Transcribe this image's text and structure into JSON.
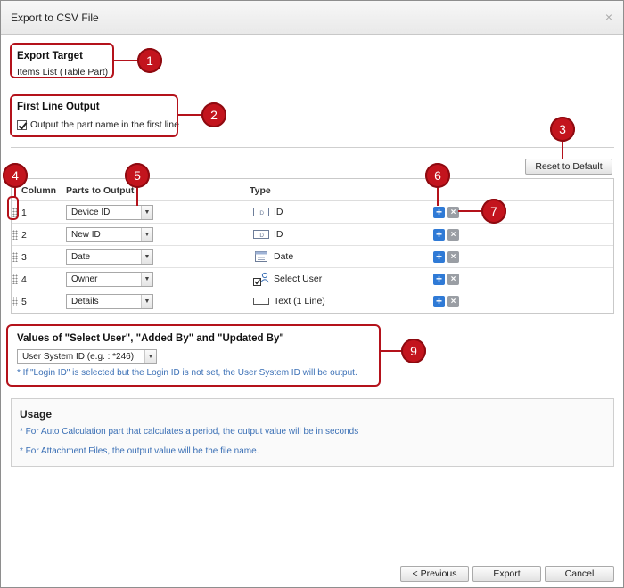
{
  "window": {
    "title": "Export to CSV File",
    "close_glyph": "×"
  },
  "export_target": {
    "title": "Export Target",
    "value": "Items List (Table Part)"
  },
  "first_line": {
    "title": "First Line Output",
    "checkbox_label": "Output the part name in the first line",
    "checked": true
  },
  "toolbar": {
    "reset_label": "Reset to Default"
  },
  "table": {
    "headers": {
      "column": "Column",
      "parts": "Parts to Output",
      "type": "Type"
    },
    "rows": [
      {
        "num": "1",
        "part": "Device ID",
        "type": "ID",
        "type_icon": "id-icon"
      },
      {
        "num": "2",
        "part": "New ID",
        "type": "ID",
        "type_icon": "id-icon"
      },
      {
        "num": "3",
        "part": "Date",
        "type": "Date",
        "type_icon": "calendar-icon"
      },
      {
        "num": "4",
        "part": "Owner",
        "type": "Select User",
        "type_icon": "user-icon"
      },
      {
        "num": "5",
        "part": "Details",
        "type": "Text (1 Line)",
        "type_icon": "text-field-icon"
      }
    ],
    "add_glyph": "+",
    "remove_glyph": "×"
  },
  "values_section": {
    "title": "Values of \"Select User\", \"Added By\" and \"Updated By\"",
    "selected": "User System ID (e.g. : *246)",
    "note": "* If \"Login ID\" is selected but the Login ID is not set, the User System ID will be output."
  },
  "usage": {
    "title": "Usage",
    "line1": "* For Auto Calculation part that calculates a period, the output value will be in seconds",
    "line2": "* For Attachment Files, the output value will be the file name."
  },
  "footer": {
    "previous_label": "< Previous",
    "export_label": "Export",
    "cancel_label": "Cancel"
  },
  "callouts": [
    "1",
    "2",
    "3",
    "4",
    "5",
    "6",
    "7",
    "9"
  ],
  "colors": {
    "callout": "#c3141d",
    "link_blue": "#3a6fb5",
    "add_blue": "#2f7ad6"
  }
}
